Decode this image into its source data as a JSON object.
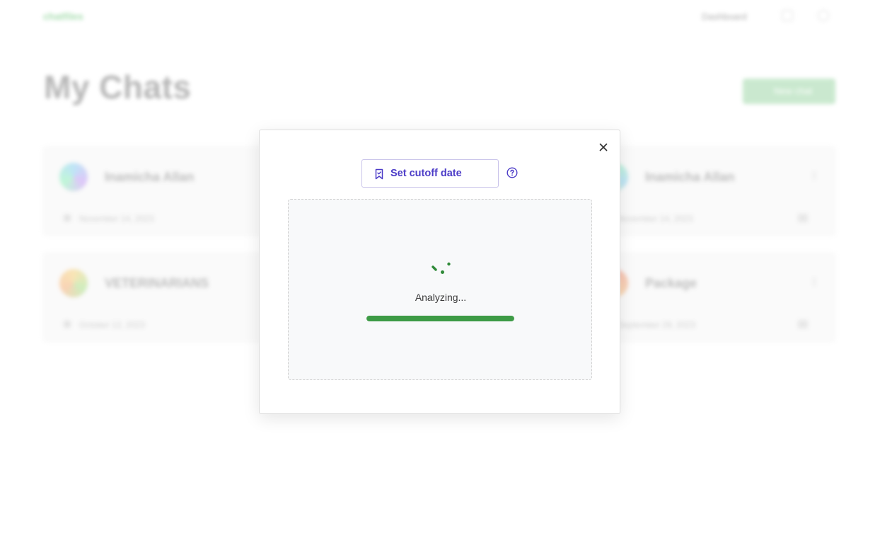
{
  "app": {
    "logo_text": "chatfiles",
    "nav": {
      "dashboard_label": "Dashboard"
    },
    "page_title": "My Chats",
    "new_chat_label": "New chat"
  },
  "chats": [
    {
      "name": "Inamicha Allan",
      "date": "November 14, 2023"
    },
    {
      "name": "Inamicha Allan",
      "date": "November 14, 2023"
    },
    {
      "name": "VETERINARIANS",
      "date": "October 12, 2023"
    },
    {
      "name": "Package",
      "date": "September 29, 2023"
    }
  ],
  "modal": {
    "cutoff_button_label": "Set cutoff date",
    "status_text": "Analyzing...",
    "progress": 1.0
  },
  "colors": {
    "accent_purple": "#4b3bc7",
    "progress_green": "#3d9b45",
    "brand_green": "#5bbf6a"
  },
  "icons": {
    "close": "close-icon",
    "cutoff": "bookmark-icon",
    "help": "help-circle-icon",
    "spinner": "loading-spinner-icon"
  }
}
